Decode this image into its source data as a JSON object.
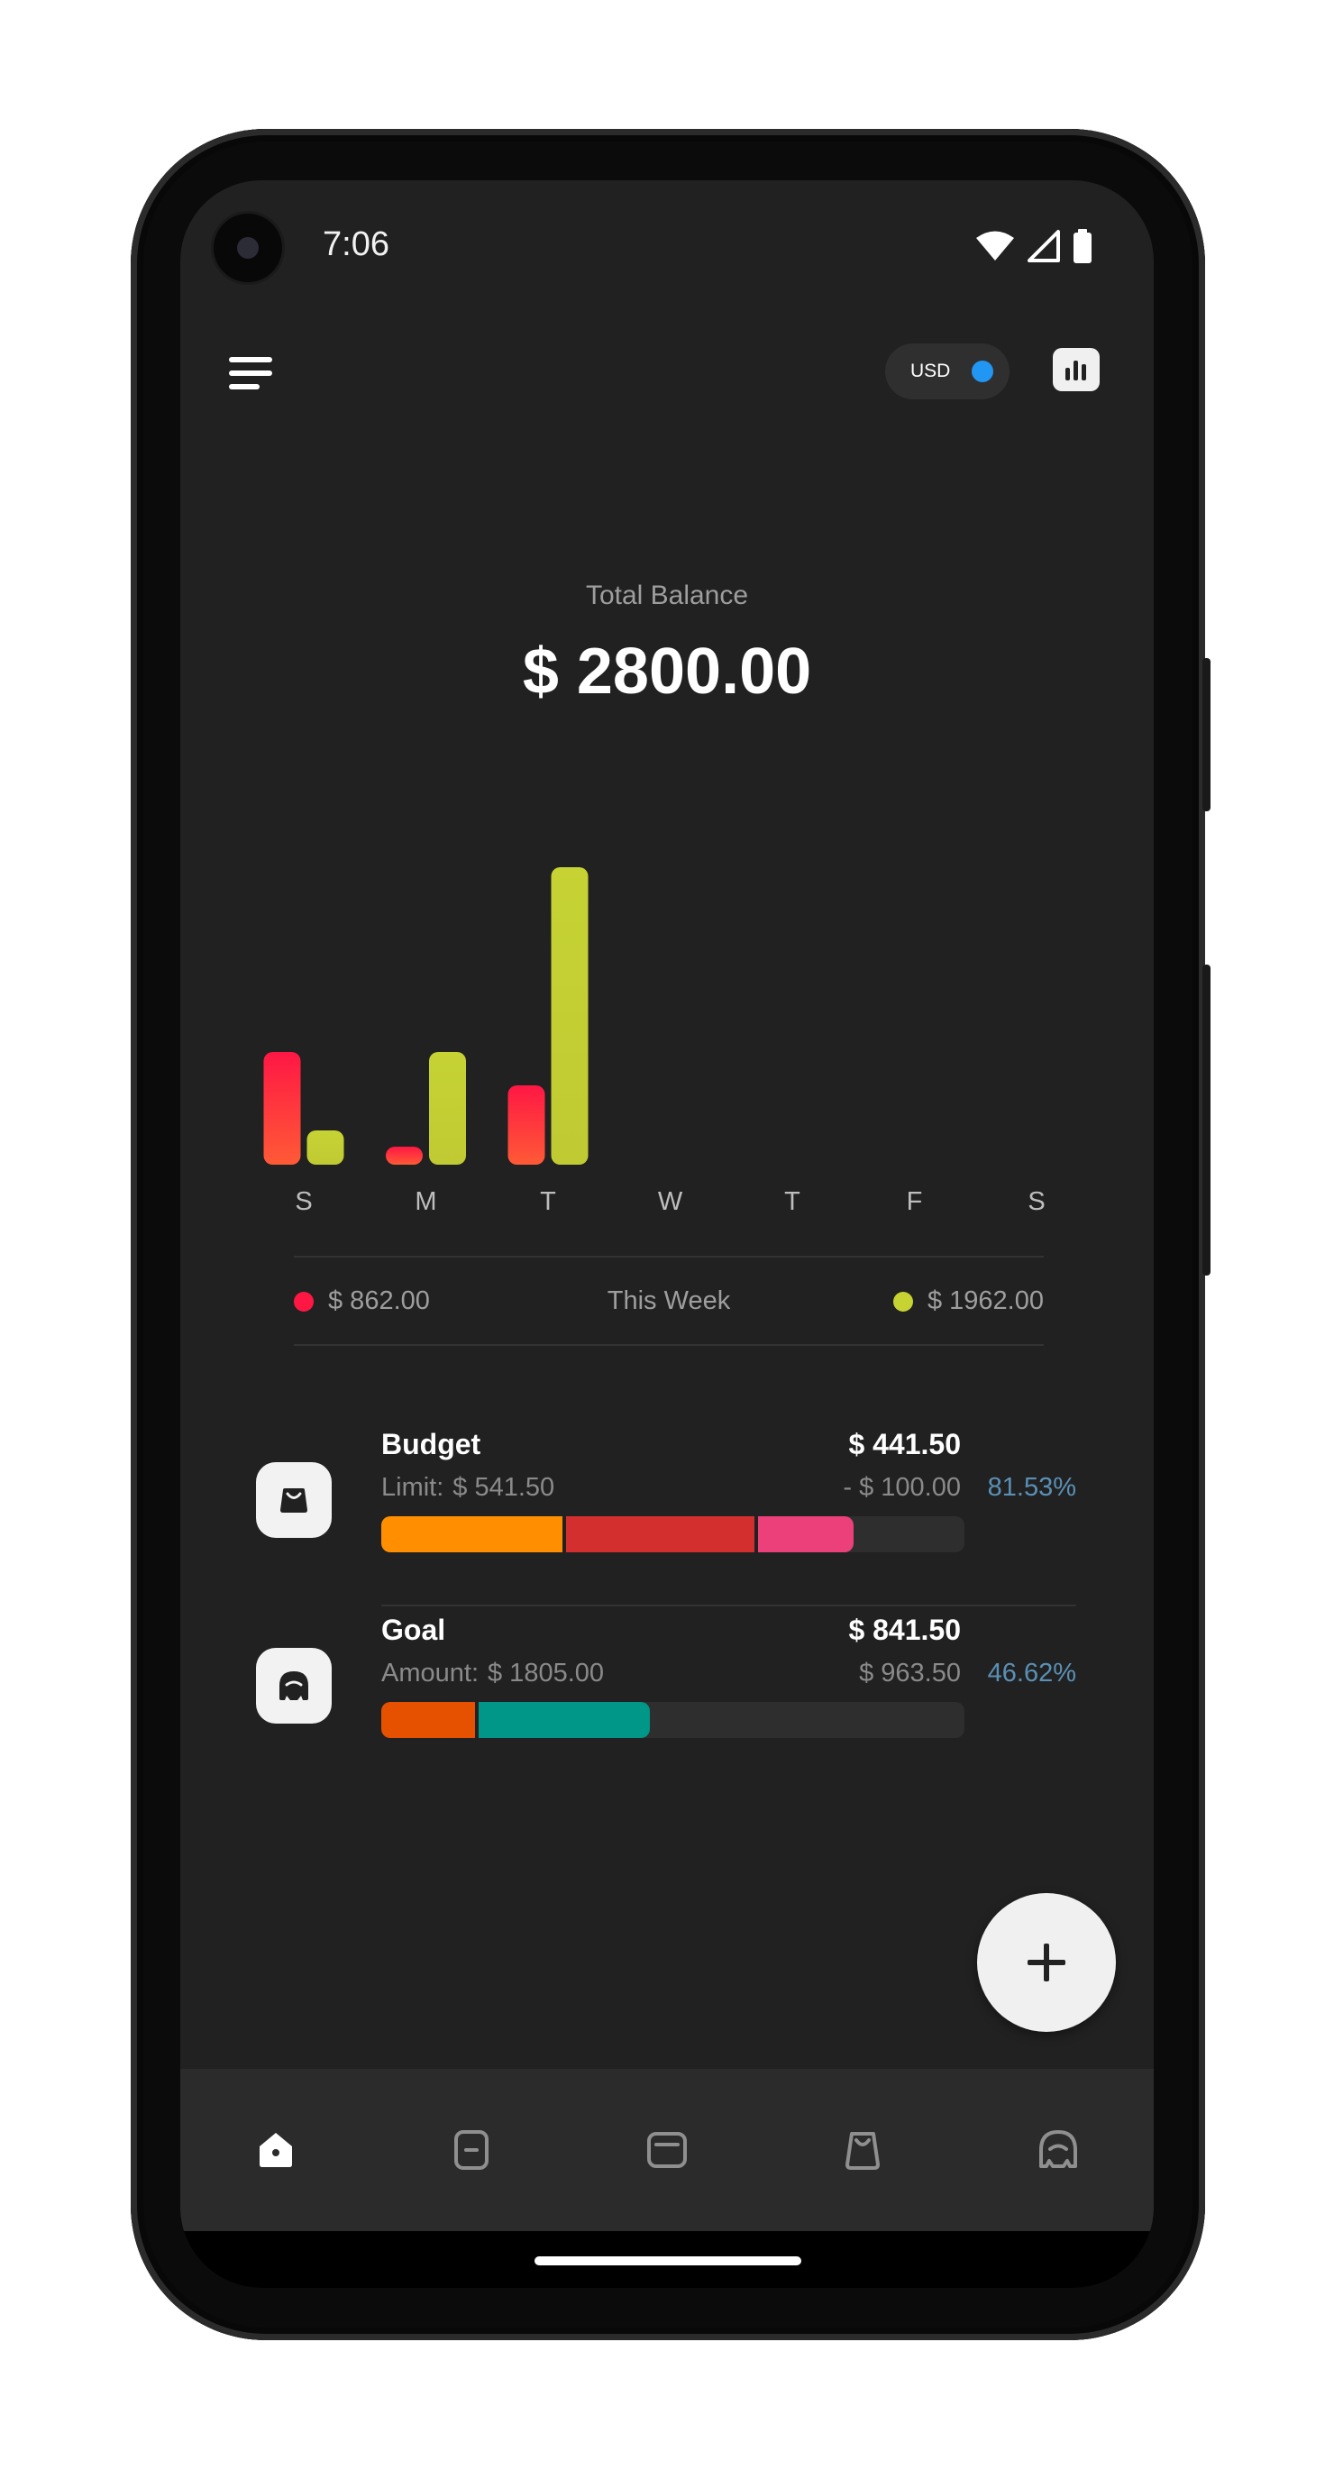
{
  "status_bar": {
    "time": "7:06",
    "icons": [
      "wifi-icon",
      "signal-icon",
      "battery-icon"
    ]
  },
  "header": {
    "menu_icon": "menu-icon",
    "currency": "USD",
    "currency_toggle_color": "#2196f3",
    "stats_icon": "bar-chart-icon"
  },
  "balance": {
    "label": "Total Balance",
    "amount": "$ 2800.00"
  },
  "chart_data": {
    "type": "bar",
    "categories": [
      "S",
      "M",
      "T",
      "W",
      "T",
      "F",
      "S"
    ],
    "series": [
      {
        "color": "#ff1744",
        "values": [
          125,
          20,
          88,
          0,
          0,
          0,
          0
        ]
      },
      {
        "color": "#c6d333",
        "values": [
          38,
          125,
          330,
          0,
          0,
          0,
          0
        ]
      }
    ],
    "ylim": [
      0,
      330
    ],
    "grid": false,
    "legend_position": "bottom"
  },
  "week_summary": {
    "expense_amount": "$ 862.00",
    "label": "This Week",
    "income_amount": "$ 1962.00",
    "expense_color": "#ff1744",
    "income_color": "#c6d333"
  },
  "budget": {
    "icon": "shopping-bag-icon",
    "title": "Budget",
    "value": "$ 441.50",
    "limit_label": "Limit:",
    "limit_value": "$ 541.50",
    "diff": "- $ 100.00",
    "percent": "81.53%",
    "progress": [
      {
        "color": "#ff8f00",
        "fraction": 0.31
      },
      {
        "color": "#d32f2f",
        "fraction": 0.33
      },
      {
        "color": "#ec407a",
        "fraction": 0.17
      }
    ]
  },
  "goal": {
    "icon": "piggy-bank-icon",
    "title": "Goal",
    "value": "$ 841.50",
    "amount_label": "Amount:",
    "amount_value": "$ 1805.00",
    "diff": "$ 963.50",
    "percent": "46.62%",
    "progress": [
      {
        "color": "#e65100",
        "fraction": 0.16
      },
      {
        "color": "#009688",
        "fraction": 0.3
      }
    ]
  },
  "fab": {
    "icon": "plus-icon"
  },
  "bottom_nav": {
    "items": [
      "home-icon",
      "transactions-icon",
      "wallet-icon",
      "budget-bag-icon",
      "goal-icon"
    ],
    "active": "home-icon"
  }
}
